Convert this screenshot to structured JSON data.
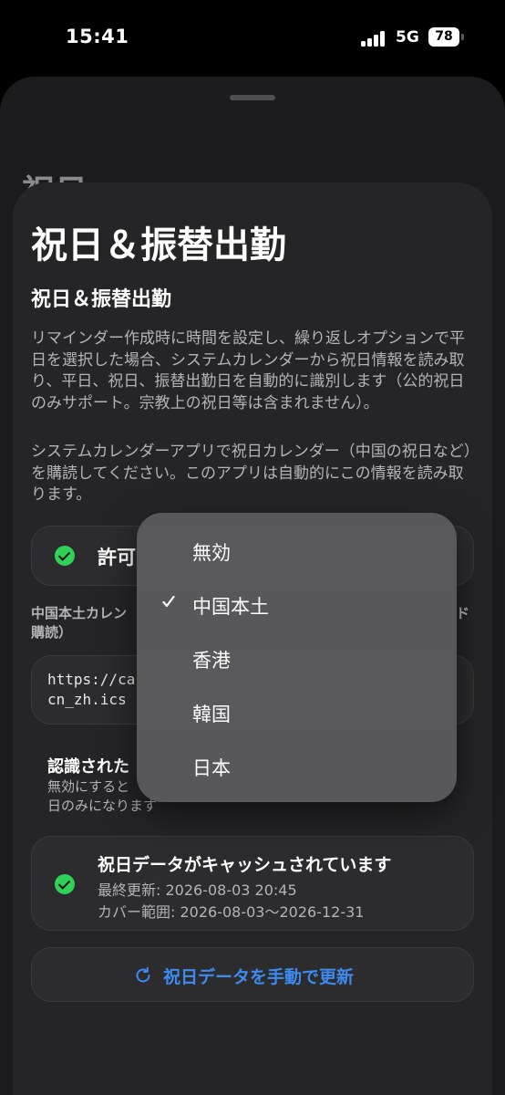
{
  "status_bar": {
    "time": "15:41",
    "network": "5G",
    "battery": "78"
  },
  "page": {
    "title": "祝日＆振替出勤",
    "section_title": "祝日＆振替出勤",
    "description_1": "リマインダー作成時に時間を設定し、繰り返しオプションで平日を選択した場合、システムカレンダーから祝日情報を読み取り、平日、祝日、振替出勤日を自動的に識別します（公的祝日のみサポート。宗教上の祝日等は含まれません）。",
    "description_2": "システムカレンダーアプリで祝日カレンダー（中国の祝日など）を購読してください。このアプリは自動的にこの情報を読み取ります。"
  },
  "permission": {
    "label": "許可"
  },
  "calendar": {
    "label_left": "中国本土カレン",
    "label_right": "ド",
    "label_line2": "購読）",
    "url_line1": "https://ca",
    "url_line2": "cn_zh.ics"
  },
  "recognition": {
    "title": "認識された",
    "desc_line1": "無効にすると",
    "desc_line2": "日のみになります"
  },
  "cache": {
    "title": "祝日データがキャッシュされています",
    "last_updated": "最終更新: 2026-08-03 20:45",
    "coverage": "カバー範囲: 2026-08-03～2026-12-31"
  },
  "refresh": {
    "label": "祝日データを手動で更新"
  },
  "region_menu": {
    "selected": "中国本土",
    "items": [
      {
        "label": "無効",
        "selected": false
      },
      {
        "label": "中国本土",
        "selected": true
      },
      {
        "label": "香港",
        "selected": false
      },
      {
        "label": "韓国",
        "selected": false
      },
      {
        "label": "日本",
        "selected": false
      }
    ]
  },
  "colors": {
    "accent": "#3d8bf0",
    "success": "#30d158",
    "card_bg": "#252527"
  }
}
